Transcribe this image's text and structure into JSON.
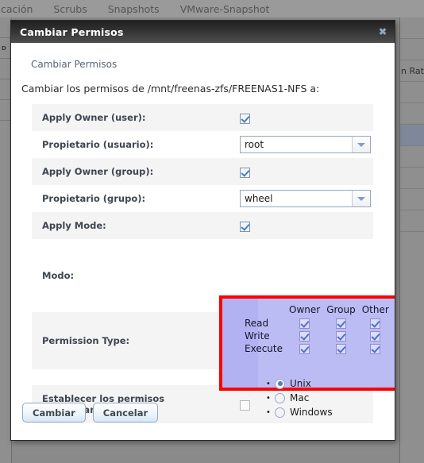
{
  "background": {
    "nav_items": [
      "licación",
      "Scrubs",
      "Snapshots",
      "VMware-Snapshot"
    ],
    "table_column_header": "n Ratio"
  },
  "dialog": {
    "title": "Cambiar Permisos",
    "close_icon": "close-icon",
    "close_glyph": "✖",
    "subtitle": "Cambiar Permisos",
    "description": "Cambiar los permisos de /mnt/freenas-zfs/FREENAS1-NFS a:",
    "rows": [
      {
        "label": "Apply Owner (user):",
        "type": "checkbox",
        "checked": true
      },
      {
        "label": "Propietario (usuario):",
        "type": "select",
        "value": "root"
      },
      {
        "label": "Apply Owner (group):",
        "type": "checkbox",
        "checked": true
      },
      {
        "label": "Propietario (grupo):",
        "type": "select",
        "value": "wheel"
      },
      {
        "label": "Apply Mode:",
        "type": "checkbox",
        "checked": true
      },
      {
        "label": "Modo:",
        "type": "mode-grid"
      },
      {
        "label": "Permission Type:",
        "type": "radio-group"
      },
      {
        "label": "Establecer los permisos recursivamente:",
        "type": "checkbox",
        "checked": false
      }
    ],
    "row_labels": {
      "apply_owner_user": "Apply Owner (user):",
      "owner_user": "Propietario (usuario):",
      "apply_owner_group": "Apply Owner (group):",
      "owner_group": "Propietario (grupo):",
      "apply_mode": "Apply Mode:",
      "mode": "Modo:",
      "permission_type": "Permission Type:",
      "recursive": "Establecer los permisos recursivamente:"
    },
    "values": {
      "owner_user": "root",
      "owner_group": "wheel"
    },
    "mode_grid": {
      "columns": [
        "Owner",
        "Group",
        "Other"
      ],
      "rows": [
        "Read",
        "Write",
        "Execute"
      ],
      "checked": [
        [
          true,
          true,
          true
        ],
        [
          true,
          true,
          true
        ],
        [
          true,
          true,
          true
        ]
      ],
      "highlight_color": "#ff0000",
      "panel_color": "#bcbcf5"
    },
    "permission_types": [
      {
        "label": "Unix",
        "selected": true
      },
      {
        "label": "Mac",
        "selected": false
      },
      {
        "label": "Windows",
        "selected": false
      }
    ],
    "buttons": {
      "submit": "Cambiar",
      "cancel": "Cancelar"
    }
  }
}
